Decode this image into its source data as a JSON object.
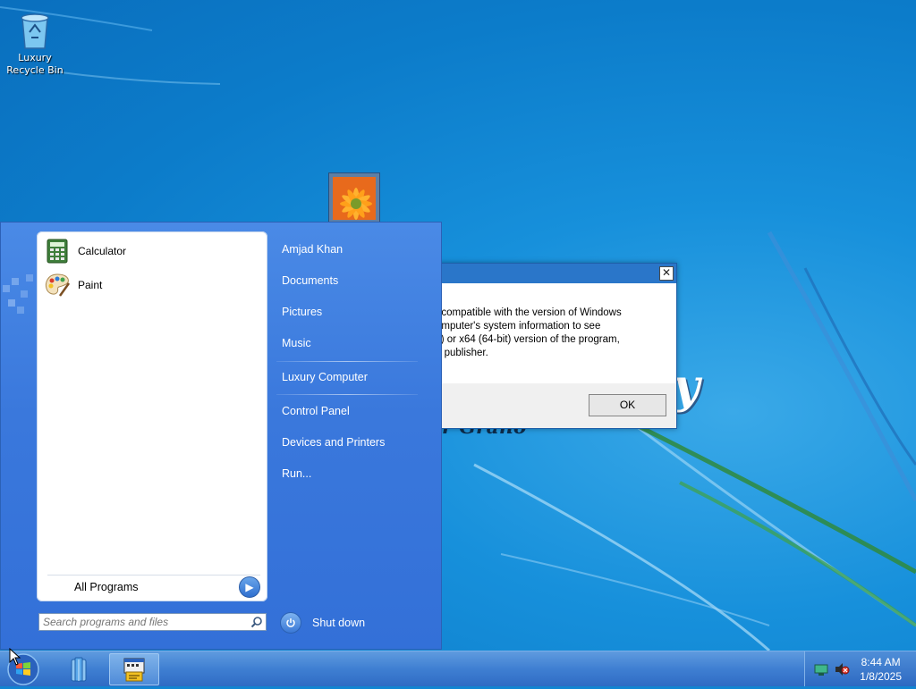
{
  "desktop": {
    "icons": [
      {
        "label": "Luxury\nRecycle Bin",
        "icon": "recycle-bin-icon"
      }
    ],
    "brand_text_large": "y",
    "brand_text_small": "r Grano"
  },
  "dialog": {
    "close_label": "✕",
    "message_lines": [
      "t compatible with the version of Windows",
      "omputer's system information to see",
      "it) or x64 (64-bit) version of the program,",
      "e publisher."
    ],
    "ok_label": "OK"
  },
  "start_menu": {
    "pinned": [
      {
        "label": "Calculator",
        "icon": "calculator-icon"
      },
      {
        "label": "Paint",
        "icon": "paint-palette-icon"
      }
    ],
    "all_programs_label": "All Programs",
    "search": {
      "placeholder": "Search programs and files",
      "value": ""
    },
    "right_items": {
      "user": "Amjad Khan",
      "documents": "Documents",
      "pictures": "Pictures",
      "music": "Music",
      "computer": "Luxury Computer",
      "control_panel": "Control Panel",
      "devices": "Devices and Printers",
      "run": "Run..."
    },
    "shutdown_label": "Shut down"
  },
  "taskbar": {
    "buttons": [
      {
        "icon": "file-explorer-icon"
      },
      {
        "icon": "program-compatibility-icon",
        "active": true
      }
    ],
    "clock": {
      "time": "8:44 AM",
      "date": "1/8/2025"
    },
    "tray_icons": [
      "network-icon",
      "volume-icon"
    ]
  },
  "colors": {
    "accent": "#3a78dc",
    "taskbar": "#3f7fd2",
    "desktop": "#1185d2"
  }
}
